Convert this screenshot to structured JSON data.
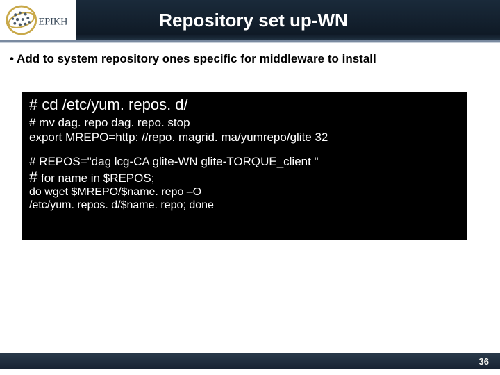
{
  "logo_text": "EPIKH",
  "title": "Repository set up-WN",
  "bullet": "• Add to system repository ones specific for middleware to install",
  "code": {
    "l1": "# cd /etc/yum. repos. d/",
    "l2a": "# mv dag. repo dag. repo. stop",
    "l2b": "export  MREPO=http: //repo. magrid. ma/yumrepo/glite 32",
    "l3": "# REPOS=\"dag lcg-CA glite-WN glite-TORQUE_client \"",
    "l4_big": "#",
    "l4_sm": " for name in $REPOS;",
    "l5a": "do wget $MREPO/$name. repo –O",
    "l5b": "/etc/yum. repos. d/$name. repo; done"
  },
  "page_number": "36"
}
